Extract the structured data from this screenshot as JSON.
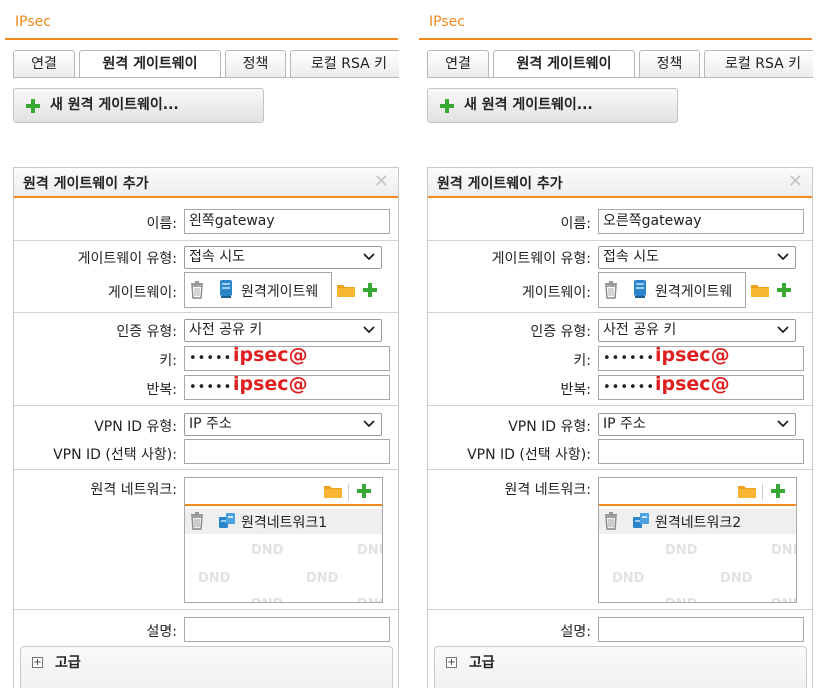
{
  "panels": [
    {
      "app_title": "IPsec",
      "tabs": [
        "연결",
        "원격 게이트웨이",
        "정책",
        "로컬 RSA 키"
      ],
      "new_button_label": "새 원격 게이트웨이...",
      "dialog": {
        "title": "원격 게이트웨이 추가",
        "name_label": "이름:",
        "name_value": "왼쪽gateway",
        "gateway_type_label": "게이트웨이 유형:",
        "gateway_type_value": "접속 시도",
        "gateway_label": "게이트웨이:",
        "gateway_value": "원격게이트웨",
        "auth_type_label": "인증 유형:",
        "auth_type_value": "사전 공유 키",
        "key_label": "키:",
        "key_dots": "••••••",
        "key_annotation": "ipsec@",
        "repeat_label": "반복:",
        "repeat_dots": "••••••",
        "repeat_annotation": "ipsec@",
        "vpn_id_type_label": "VPN ID 유형:",
        "vpn_id_type_value": "IP 주소",
        "vpn_id_label": "VPN ID (선택 사항):",
        "vpn_id_value": "",
        "remote_network_label": "원격 네트워크:",
        "remote_network_item": "원격네트워크1",
        "dnd_text": "DND",
        "description_label": "설명:",
        "description_value": "",
        "advanced_label": "고급"
      }
    },
    {
      "app_title": "IPsec",
      "tabs": [
        "연결",
        "원격 게이트웨이",
        "정책",
        "로컬 RSA 키"
      ],
      "new_button_label": "새 원격 게이트웨이...",
      "dialog": {
        "title": "원격 게이트웨이 추가",
        "name_label": "이름:",
        "name_value": "오른쪽gateway",
        "gateway_type_label": "게이트웨이 유형:",
        "gateway_type_value": "접속 시도",
        "gateway_label": "게이트웨이:",
        "gateway_value": "원격게이트웨",
        "auth_type_label": "인증 유형:",
        "auth_type_value": "사전 공유 키",
        "key_label": "키:",
        "key_dots": "••••••",
        "key_annotation": "ipsec@",
        "repeat_label": "반복:",
        "repeat_dots": "••••••",
        "repeat_annotation": "ipsec@",
        "vpn_id_type_label": "VPN ID 유형:",
        "vpn_id_type_value": "IP 주소",
        "vpn_id_label": "VPN ID (선택 사항):",
        "vpn_id_value": "",
        "remote_network_label": "원격 네트워크:",
        "remote_network_item": "원격네트워크2",
        "dnd_text": "DND",
        "description_label": "설명:",
        "description_value": "",
        "advanced_label": "고급"
      }
    }
  ],
  "colors": {
    "accent": "#f08a1c",
    "annotation": "#e02020",
    "add_green": "#3aa835"
  },
  "icons": [
    "plus-icon",
    "close-icon",
    "chevron-down-icon",
    "trash-icon",
    "server-icon",
    "folder-icon",
    "network-icon",
    "expand-icon"
  ]
}
